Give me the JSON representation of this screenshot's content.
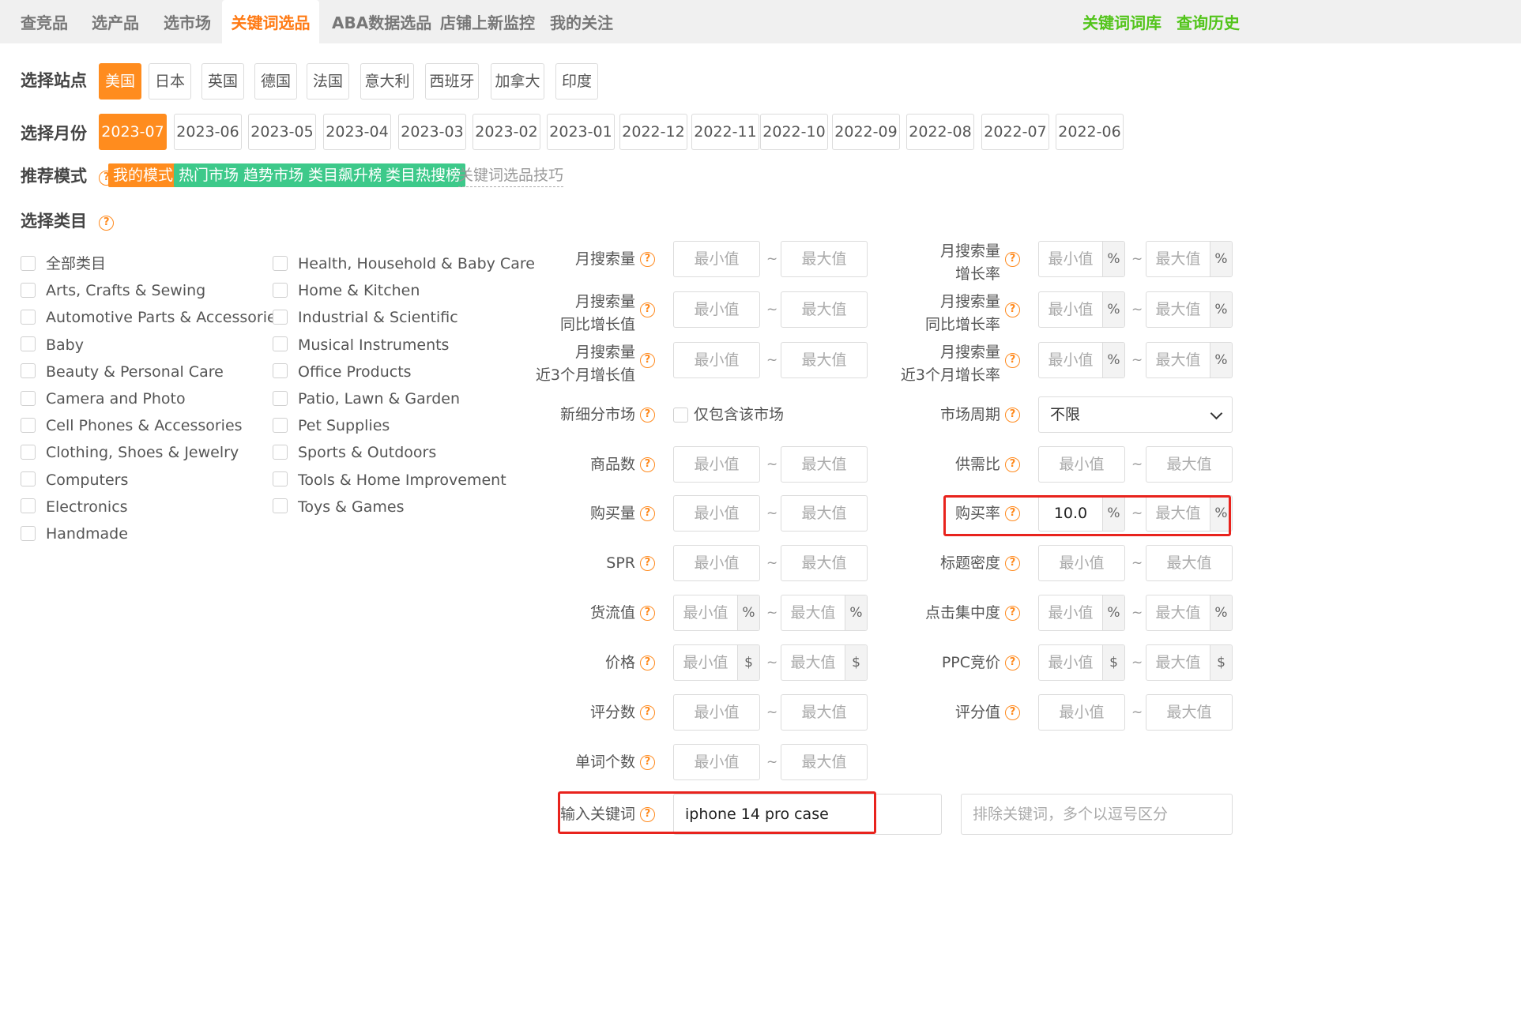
{
  "tabs": [
    {
      "label": "查竞品"
    },
    {
      "label": "选产品"
    },
    {
      "label": "选市场"
    },
    {
      "label": "关键词选品"
    },
    {
      "label": "ABA数据选品"
    },
    {
      "label": "店铺上新监控"
    },
    {
      "label": "我的关注"
    }
  ],
  "active_tab": "关键词选品",
  "top_links": {
    "keyword_library": "关键词词库",
    "query_history": "查询历史"
  },
  "site": {
    "label": "选择站点",
    "options": [
      "美国",
      "日本",
      "英国",
      "德国",
      "法国",
      "意大利",
      "西班牙",
      "加拿大",
      "印度"
    ],
    "selected": "美国"
  },
  "month": {
    "label": "选择月份",
    "options": [
      "2023-07",
      "2023-06",
      "2023-05",
      "2023-04",
      "2023-03",
      "2023-02",
      "2023-01",
      "2022-12",
      "2022-11",
      "2022-10",
      "2022-09",
      "2022-08",
      "2022-07",
      "2022-06"
    ],
    "selected": "2023-07"
  },
  "mode": {
    "label": "推荐模式",
    "items": [
      "我的模式",
      "热门市场",
      "趋势市场",
      "类目飙升榜",
      "类目热搜榜"
    ],
    "tips_link": "关键词选品技巧"
  },
  "category": {
    "label": "选择类目",
    "left": [
      "全部类目",
      "Arts, Crafts & Sewing",
      "Automotive Parts & Accessories",
      "Baby",
      "Beauty & Personal Care",
      "Camera and Photo",
      "Cell Phones & Accessories",
      "Clothing, Shoes & Jewelry",
      "Computers",
      "Electronics",
      "Handmade"
    ],
    "right": [
      "Health, Household & Baby Care",
      "Home & Kitchen",
      "Industrial & Scientific",
      "Musical Instruments",
      "Office Products",
      "Patio, Lawn & Garden",
      "Pet Supplies",
      "Sports & Outdoors",
      "Tools & Home Improvement",
      "Toys & Games"
    ]
  },
  "placeholders": {
    "min": "最小值",
    "max": "最大值"
  },
  "tilde": "~",
  "filters": {
    "monthly_search": {
      "label": "月搜索量"
    },
    "monthly_search_growth_rate": {
      "line1": "月搜索量",
      "line2": "增长率",
      "suffix": "%"
    },
    "monthly_search_yoy_value": {
      "line1": "月搜索量",
      "line2": "同比增长值"
    },
    "monthly_search_yoy_rate": {
      "line1": "月搜索量",
      "line2": "同比增长率",
      "suffix": "%"
    },
    "monthly_search_3m_value": {
      "line1": "月搜索量",
      "line2": "近3个月增长值"
    },
    "monthly_search_3m_rate": {
      "line1": "月搜索量",
      "line2": "近3个月增长率",
      "suffix": "%"
    },
    "new_niche": {
      "label": "新细分市场",
      "checkbox_label": "仅包含该市场"
    },
    "market_cycle": {
      "label": "市场周期",
      "value": "不限"
    },
    "product_count": {
      "label": "商品数"
    },
    "supply_demand": {
      "label": "供需比"
    },
    "purchase_volume": {
      "label": "购买量"
    },
    "purchase_rate": {
      "label": "购买率",
      "min_value": "10.0",
      "suffix": "%"
    },
    "spr": {
      "label": "SPR"
    },
    "title_density": {
      "label": "标题密度"
    },
    "goods_flow": {
      "label": "货流值",
      "suffix": "%"
    },
    "click_concentration": {
      "label": "点击集中度",
      "suffix": "%"
    },
    "price": {
      "label": "价格",
      "suffix": "$"
    },
    "ppc_bid": {
      "label": "PPC竞价",
      "suffix": "$"
    },
    "review_count": {
      "label": "评分数"
    },
    "rating": {
      "label": "评分值"
    },
    "word_count": {
      "label": "单词个数"
    }
  },
  "keyword": {
    "label": "输入关键词",
    "value": "iphone 14 pro case",
    "exclude_placeholder": "排除关键词，多个以逗号区分"
  }
}
